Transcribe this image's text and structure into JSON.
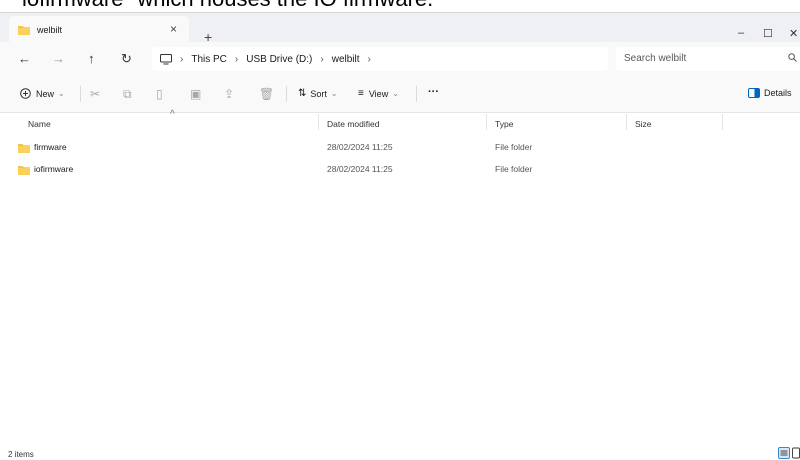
{
  "caption_text": "iofirmware\" which houses the IO firmware.",
  "window": {
    "tab_title": "welbilt",
    "tab_close": "×",
    "new_tab": "+",
    "minimize": "–",
    "maximize": "☐",
    "close": "✕"
  },
  "nav": {
    "back": "←",
    "forward": "→",
    "up": "↑",
    "refresh": "↻"
  },
  "breadcrumb": {
    "items": [
      "This PC",
      "USB Drive (D:)",
      "welbilt"
    ]
  },
  "search": {
    "placeholder": "Search welbilt"
  },
  "toolbar": {
    "new_label": "New",
    "sort_label": "Sort",
    "view_label": "View",
    "more_label": "···",
    "details_label": "Details"
  },
  "columns": [
    "Name",
    "Date modified",
    "Type",
    "Size"
  ],
  "files": [
    {
      "name": "firmware",
      "date_modified": "28/02/2024 11:25",
      "type": "File folder",
      "size": ""
    },
    {
      "name": "iofirmware",
      "date_modified": "28/02/2024 11:25",
      "type": "File folder",
      "size": ""
    }
  ],
  "status": {
    "item_count": "2 items"
  },
  "colors": {
    "folder": "#f4c542",
    "accent": "#0067c0",
    "chrome": "#eef0f3"
  }
}
